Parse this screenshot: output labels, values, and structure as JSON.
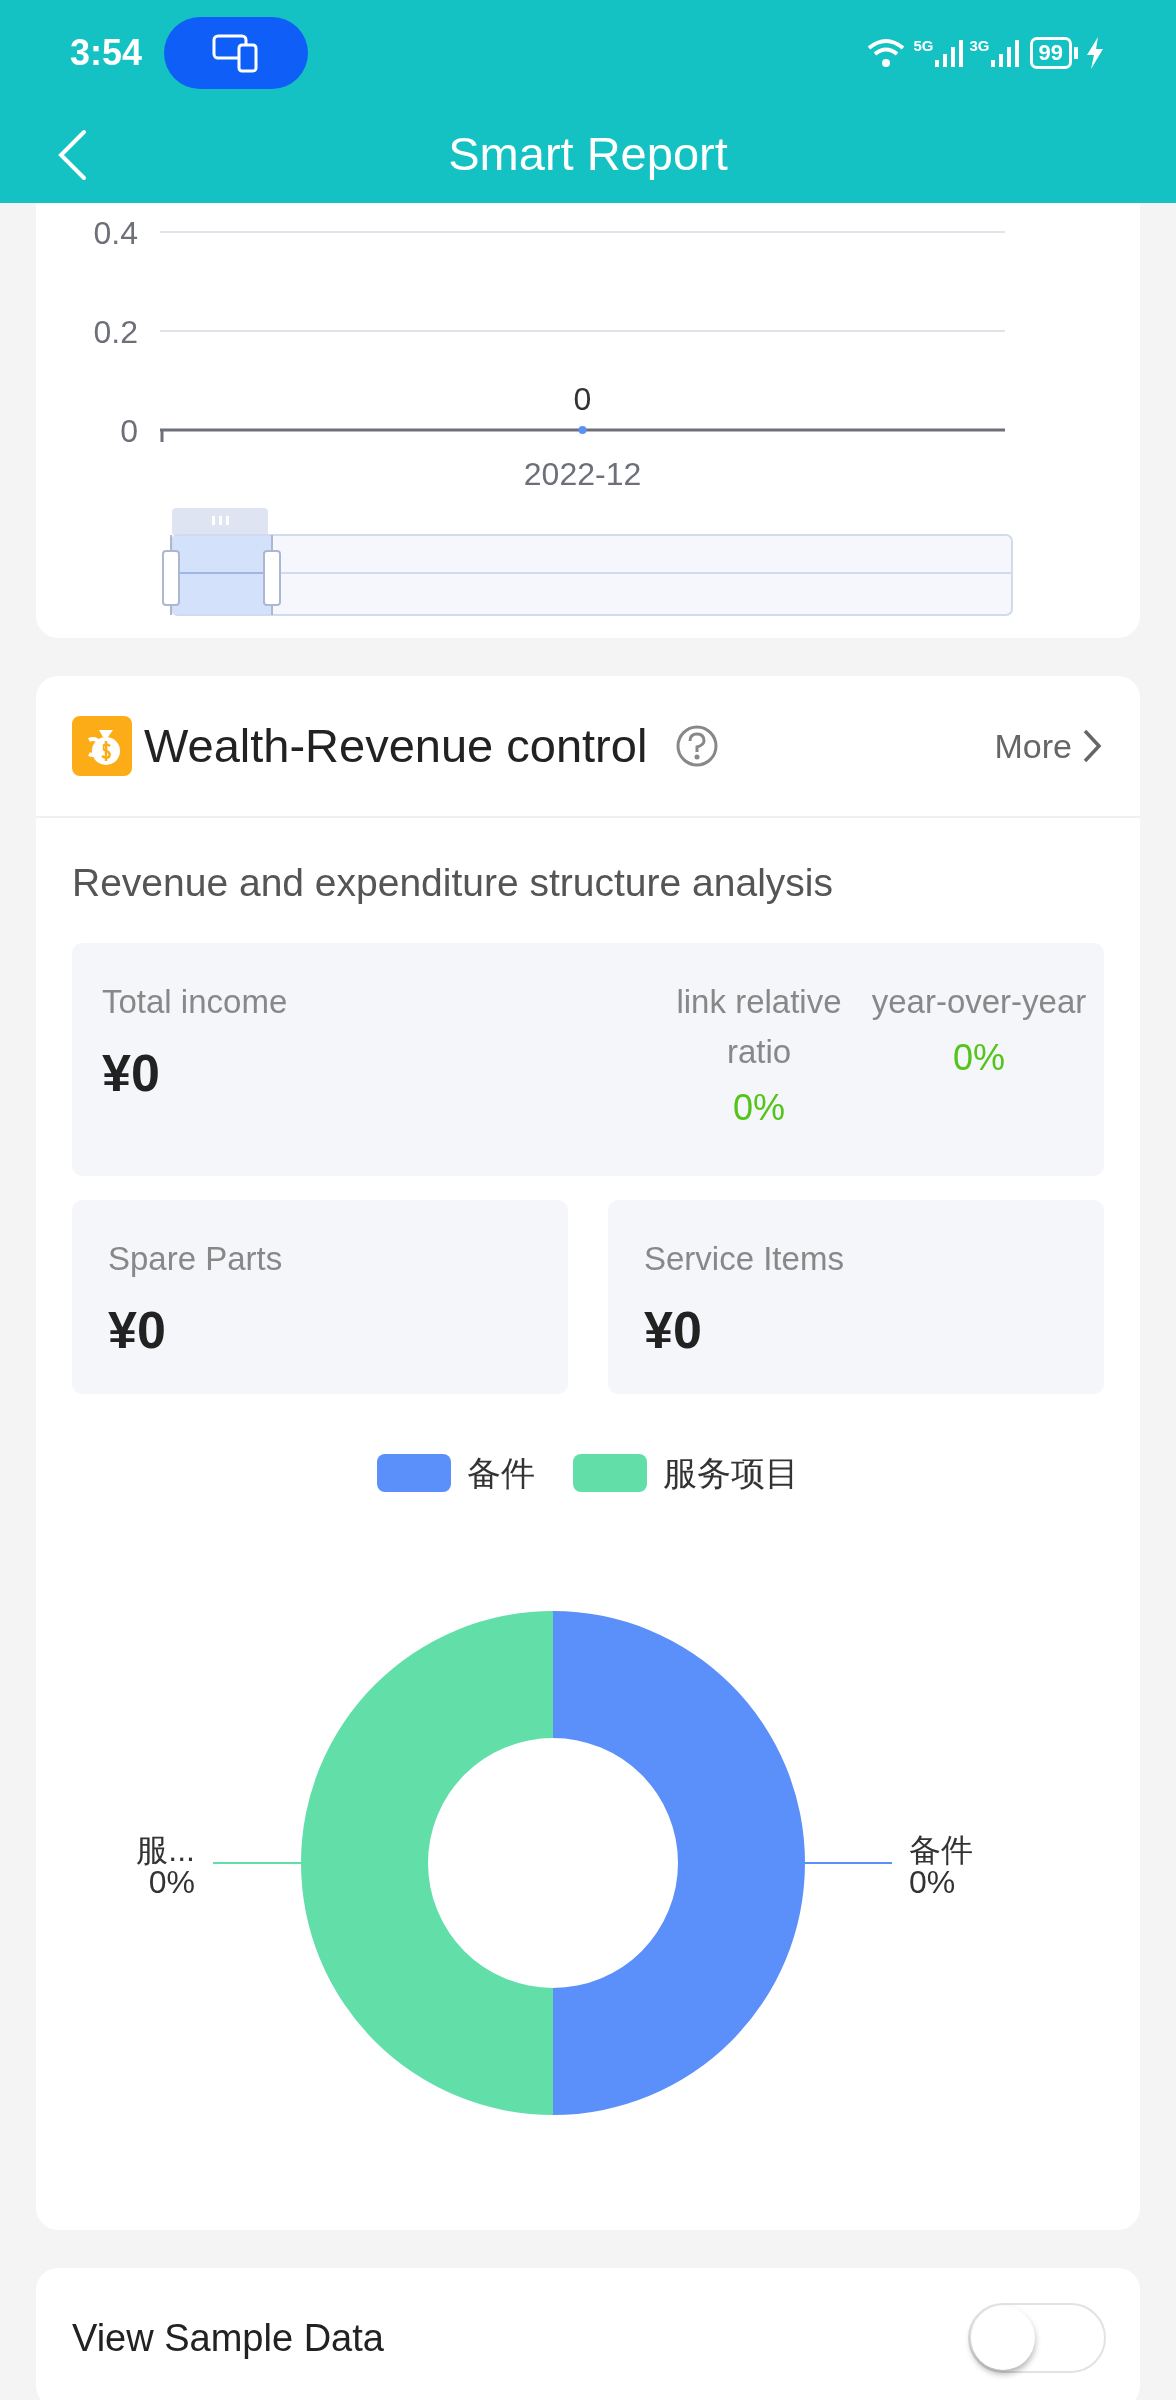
{
  "status_bar": {
    "time": "3:54",
    "network_1": "5G",
    "network_2": "3G",
    "battery": "99"
  },
  "nav": {
    "title": "Smart Report"
  },
  "trend_chart": {
    "chart_data": {
      "type": "line",
      "categories": [
        "2022-12"
      ],
      "series": [
        {
          "color": "#5b8ff9",
          "marker": true,
          "values": [
            0
          ]
        }
      ],
      "ylim": [
        0,
        0.4
      ],
      "yticks": [
        0,
        0.2,
        0.4
      ],
      "data_labels": true
    }
  },
  "wealth_card": {
    "title": "Wealth-Revenue control",
    "more": "More",
    "subtitle": "Revenue and expenditure structure analysis",
    "total": {
      "label": "Total income",
      "value": "¥0"
    },
    "ratios": [
      {
        "label": "link relative ratio",
        "value": "0%"
      },
      {
        "label": "year-over-year",
        "value": "0%"
      }
    ],
    "parts": [
      {
        "label": "Spare Parts",
        "value": "¥0"
      },
      {
        "label": "Service Items",
        "value": "¥0"
      }
    ],
    "legend": [
      {
        "label": "备件",
        "color": "#5b8ff9"
      },
      {
        "label": "服务项目",
        "color": "#62dea9"
      }
    ],
    "slice_labels": [
      {
        "kind": "left",
        "name": "服...",
        "value": "0%",
        "color": "#62dea9"
      },
      {
        "kind": "right",
        "name": "备件",
        "value": "0%",
        "color": "#5b8ff9"
      }
    ]
  },
  "sample_data": {
    "label": "View Sample Data",
    "on": false
  }
}
